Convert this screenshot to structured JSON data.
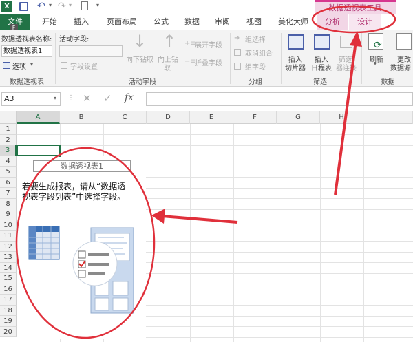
{
  "qat": {
    "app_icon": "excel-logo",
    "app_badge": "X",
    "file_badge": "F"
  },
  "tabs": [
    {
      "label": "文件"
    },
    {
      "label": "开始"
    },
    {
      "label": "插入"
    },
    {
      "label": "页面布局"
    },
    {
      "label": "公式"
    },
    {
      "label": "数据"
    },
    {
      "label": "审阅"
    },
    {
      "label": "视图"
    },
    {
      "label": "美化大师"
    },
    {
      "label": "分析"
    },
    {
      "label": "设计"
    }
  ],
  "context_title": "数据透视表工具",
  "ribbon": {
    "pt_name_label": "数据透视表名称:",
    "pt_name_value": "数据透视表1",
    "options_label": "选项",
    "active_field_label": "活动字段:",
    "field_settings": "字段设置",
    "drill_down": "向下钻取",
    "drill_up": "向上钻",
    "drill_up2": "取",
    "expand_field": "展开字段",
    "collapse_field": "折叠字段",
    "group_selection": "组选择",
    "ungroup": "取消组合",
    "group_field": "组字段",
    "insert_slicer": [
      "插入",
      "切片器"
    ],
    "insert_timeline": [
      "插入",
      "日程表"
    ],
    "filter_conn": [
      "筛选",
      "器连接"
    ],
    "refresh": "刷新",
    "change_source": [
      "更改",
      "数据源"
    ],
    "groups": [
      "数据透视表",
      "活动字段",
      "分组",
      "筛选",
      "数据"
    ]
  },
  "formula_bar": {
    "name_box": "A3",
    "cancel": "✕",
    "enter": "✓",
    "fx": "fx",
    "formula": ""
  },
  "columns": [
    "A",
    "B",
    "C",
    "D",
    "E",
    "F",
    "G",
    "H",
    "I"
  ],
  "rows": [
    "1",
    "2",
    "3",
    "4",
    "5",
    "6",
    "7",
    "8",
    "9",
    "10",
    "11",
    "12",
    "13",
    "14",
    "15",
    "16",
    "17",
    "18",
    "19",
    "20"
  ],
  "pivot": {
    "title": "数据透视表1",
    "instruction_line1": "若要生成报表，请从“数据透",
    "instruction_line2": "视表字段列表”中选择字段。"
  },
  "colors": {
    "excel_green": "#217346",
    "annotation_red": "#e0303b",
    "context_pink": "#d6378f"
  }
}
